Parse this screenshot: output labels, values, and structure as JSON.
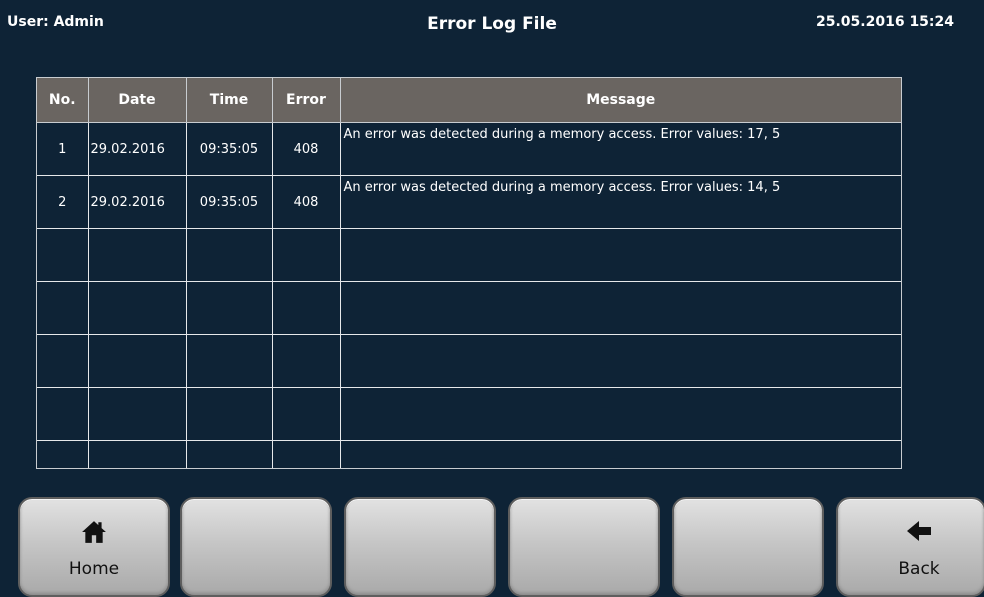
{
  "header": {
    "user": "User: Admin",
    "title": "Error Log File",
    "datetime": "25.05.2016 15:24"
  },
  "table": {
    "columns": [
      "No.",
      "Date",
      "Time",
      "Error",
      "Message"
    ],
    "rows": [
      {
        "no": "1",
        "date": "29.02.2016",
        "time": "09:35:05",
        "error": "408",
        "message": "An error was detected during a memory access. Error values: 17, 5"
      },
      {
        "no": "2",
        "date": "29.02.2016",
        "time": "09:35:05",
        "error": "408",
        "message": "An error was detected during a memory access. Error values: 14, 5"
      },
      {
        "no": "",
        "date": "",
        "time": "",
        "error": "",
        "message": ""
      },
      {
        "no": "",
        "date": "",
        "time": "",
        "error": "",
        "message": ""
      },
      {
        "no": "",
        "date": "",
        "time": "",
        "error": "",
        "message": ""
      },
      {
        "no": "",
        "date": "",
        "time": "",
        "error": "",
        "message": ""
      },
      {
        "no": "",
        "date": "",
        "time": "",
        "error": "",
        "message": ""
      }
    ]
  },
  "toolbar": {
    "home_label": "Home",
    "home_icon": "home-icon",
    "back_label": "Back",
    "back_icon": "arrow-left-icon"
  },
  "colors": {
    "background": "#0e2336",
    "header_row": "#6a6561",
    "button": "#c6c6c6"
  }
}
